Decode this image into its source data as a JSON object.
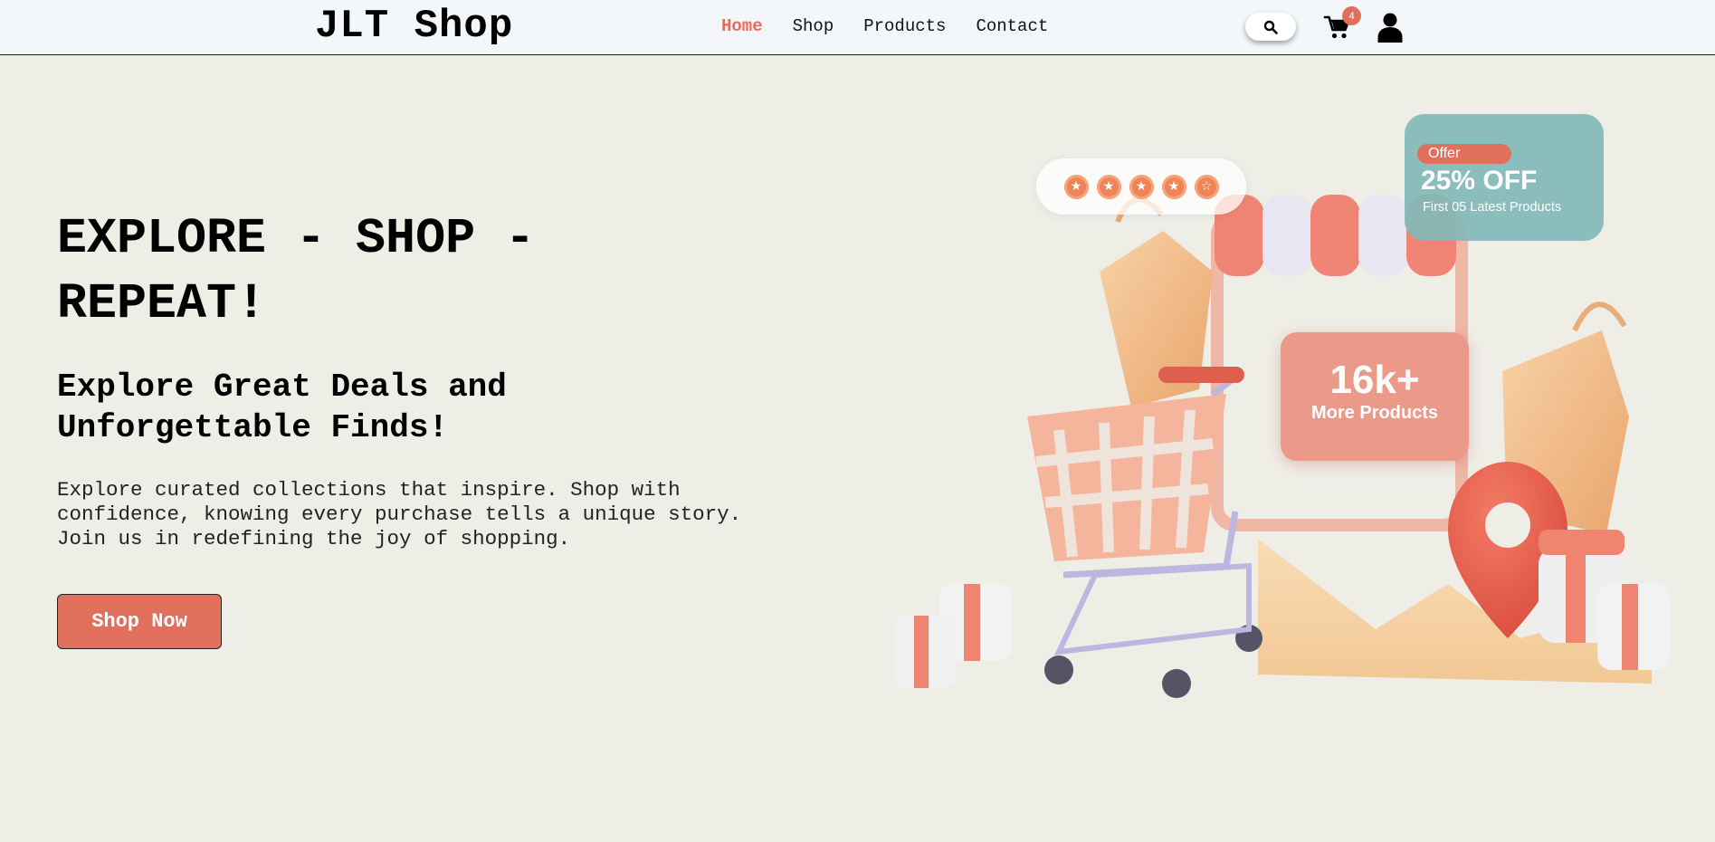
{
  "header": {
    "brand": "JLT Shop",
    "nav": [
      "Home",
      "Shop",
      "Products",
      "Contact"
    ],
    "active_nav": "Home",
    "cart_count": "4",
    "icons": [
      "search-icon",
      "cart-icon",
      "user-icon"
    ]
  },
  "hero": {
    "title": "EXPLORE - SHOP - REPEAT!",
    "subtitle": "Explore Great Deals and Unforgettable Finds!",
    "text": "Explore curated collections that inspire. Shop with confidence, knowing every purchase tells a unique story. Join us in redefining the joy of shopping.",
    "cta_label": "Shop Now"
  },
  "illustration": {
    "offer": {
      "tag": "Offer",
      "headline": "25% OFF",
      "detail": "First 05 Latest Products"
    },
    "products": {
      "count": "16k+",
      "label": "More Products"
    },
    "rating_stars": 5
  },
  "colors": {
    "accent": "#e0705c",
    "background": "#eeede6",
    "header_bg": "#f4f7f9",
    "offer_card": "#82b9b9",
    "products_card": "#eb9988"
  }
}
